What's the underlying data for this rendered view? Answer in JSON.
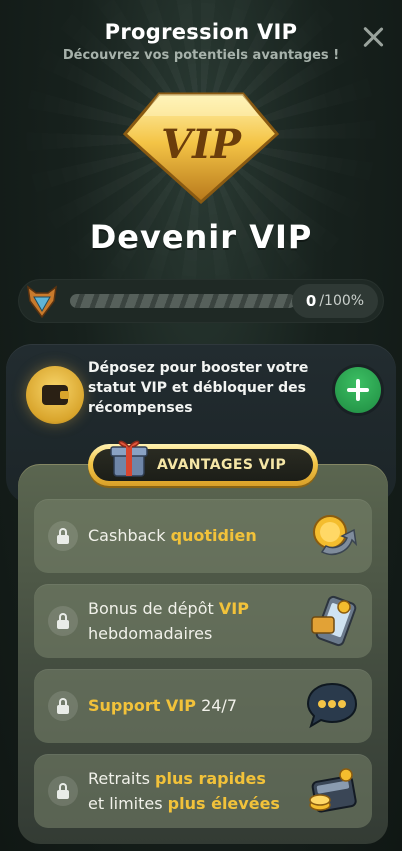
{
  "header": {
    "title": "Progression VIP",
    "subtitle": "Découvrez vos potentiels avantages !"
  },
  "badge": {
    "text": "VIP"
  },
  "hero_title": "Devenir VIP",
  "progress": {
    "value": "0",
    "max": "/100%",
    "percent": 0
  },
  "deposit": {
    "text": "Déposez pour booster votre statut VIP et débloquer des récompenses"
  },
  "perks_header": "AVANTAGES VIP",
  "perks": [
    {
      "text_a": "Cashback ",
      "text_b": "quotidien",
      "text_c": "",
      "icon": "coin-cashback-icon"
    },
    {
      "text_a": "Bonus de dépôt ",
      "text_b": "VIP",
      "text_c": "hebdomadaires",
      "icon": "phone-deposit-icon"
    },
    {
      "text_a": "Support VIP",
      "text_b": " 24/7",
      "text_c": "",
      "icon": "chat-support-icon"
    },
    {
      "text_a": "Retraits ",
      "text_b": "plus rapides",
      "text_c": "et limites ",
      "text_d": "plus élevées",
      "icon": "wallet-withdraw-icon"
    }
  ],
  "colors": {
    "accent_gold": "#f2c23a",
    "plus_green": "#2faa55"
  }
}
